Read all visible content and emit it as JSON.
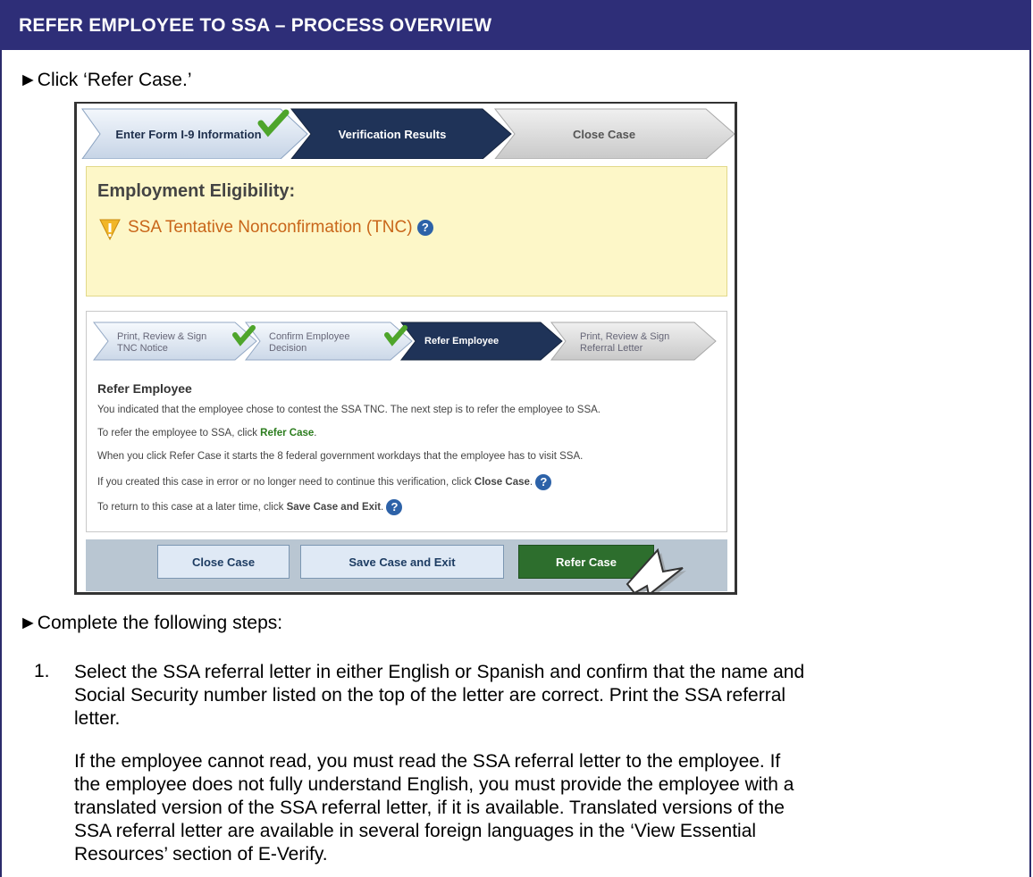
{
  "header": {
    "title": "REFER EMPLOYEE TO SSA – PROCESS OVERVIEW"
  },
  "instructions": {
    "click_bullet": "►Click ‘Refer Case.’",
    "complete_bullet": "►Complete the following steps:"
  },
  "screenshot": {
    "steps": [
      "Enter Form I-9 Information",
      "Verification Results",
      "Close Case"
    ],
    "eligibility": {
      "heading": "Employment Eligibility:",
      "status": "SSA Tentative Nonconfirmation (TNC)"
    },
    "substeps": [
      {
        "line1": "Print, Review & Sign",
        "line2": "TNC Notice"
      },
      {
        "line1": "Confirm Employee",
        "line2": "Decision"
      },
      {
        "line1": "Refer Employee",
        "line2": ""
      },
      {
        "line1": "Print, Review & Sign",
        "line2": "Referral Letter"
      }
    ],
    "refer": {
      "heading": "Refer Employee",
      "line1": "You indicated that the employee chose to contest the SSA TNC. The next step is to refer the employee to SSA.",
      "line2_prefix": "To refer the employee to SSA, click ",
      "line2_bold": "Refer Case",
      "line2_suffix": ".",
      "line3": "When you click Refer Case it starts the 8 federal government workdays that the employee has to visit SSA.",
      "line4_prefix": "If you created this case in error or no longer need to continue this verification, click ",
      "line4_bold": "Close Case",
      "line4_suffix": ".",
      "line5_prefix": "To return to this case at a later time, click ",
      "line5_bold": "Save Case and Exit",
      "line5_suffix": "."
    },
    "buttons": {
      "close": "Close Case",
      "save": "Save Case and Exit",
      "refer": "Refer Case"
    }
  },
  "steps_list": {
    "item1_num": "1.",
    "item1_line1": "Select the SSA referral letter in either English or Spanish and confirm that the name and",
    "item1_line2": "Social Security number listed on the top of the letter are correct. Print the SSA referral",
    "item1_line3": "letter.",
    "para_line1": "If the employee cannot read, you must read the SSA referral letter to the employee. If",
    "para_line2": "the employee does not fully understand English, you must provide the employee with a",
    "para_line3": "translated version of the SSA referral letter, if it is available. Translated versions of the",
    "para_line4": "SSA referral letter are available in several foreign languages in the ‘View Essential",
    "para_line5": "Resources’ section of E-Verify."
  },
  "colors": {
    "header_bg": "#2e2e78",
    "active_step": "#1f3358",
    "refer_button": "#2d6e2d",
    "tnc_status": "#c9661a"
  }
}
